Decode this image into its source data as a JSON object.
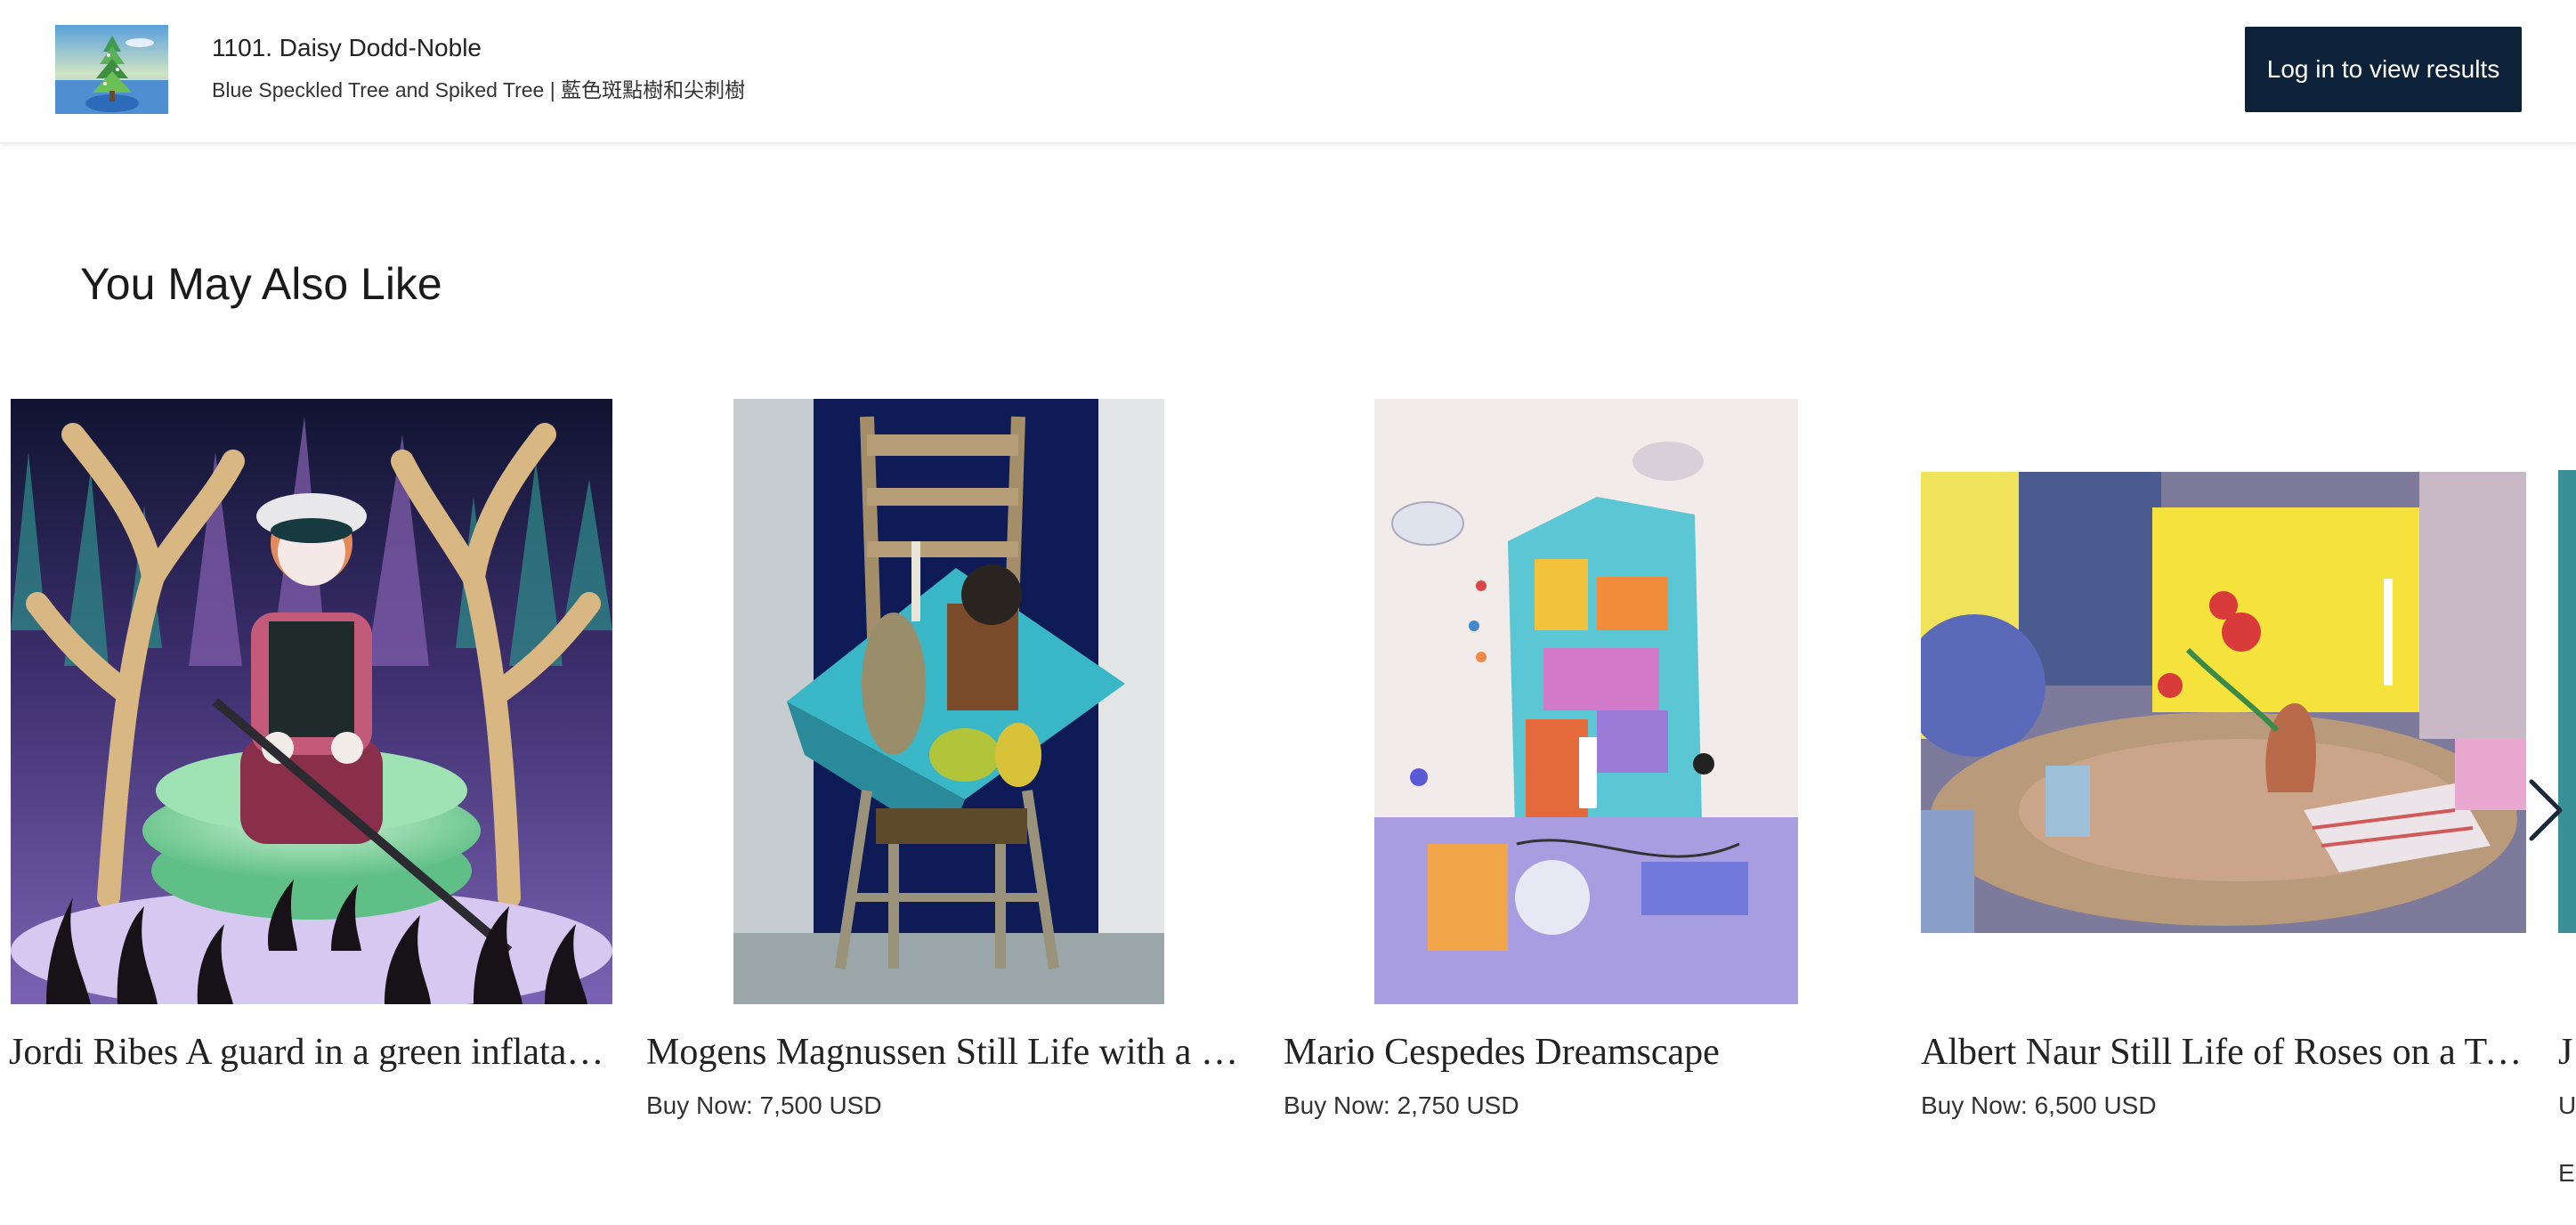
{
  "header": {
    "lot_title": "1101. Daisy Dodd-Noble",
    "lot_subtitle": "Blue Speckled Tree and Spiked Tree | 藍色斑點樹和尖刺樹",
    "login_label": "Log in to view results"
  },
  "section": {
    "title": "You May Also Like"
  },
  "cards": [
    {
      "title": "Jordi Ribes A guard in a green inflatable pool",
      "price": ""
    },
    {
      "title": "Mogens Magnussen Still Life with a Chair",
      "price": "Buy Now: 7,500 USD"
    },
    {
      "title": "Mario Cespedes Dreamscape",
      "price": "Buy Now: 2,750 USD"
    },
    {
      "title": "Albert Naur Still Life of Roses on a Table",
      "price": "Buy Now: 6,500 USD"
    },
    {
      "title": "J",
      "price": "U",
      "estimate": "Es"
    }
  ],
  "icons": {
    "next": "chevron-right-icon"
  },
  "colors": {
    "button_bg": "#0d2238",
    "button_text": "#ffffff"
  }
}
